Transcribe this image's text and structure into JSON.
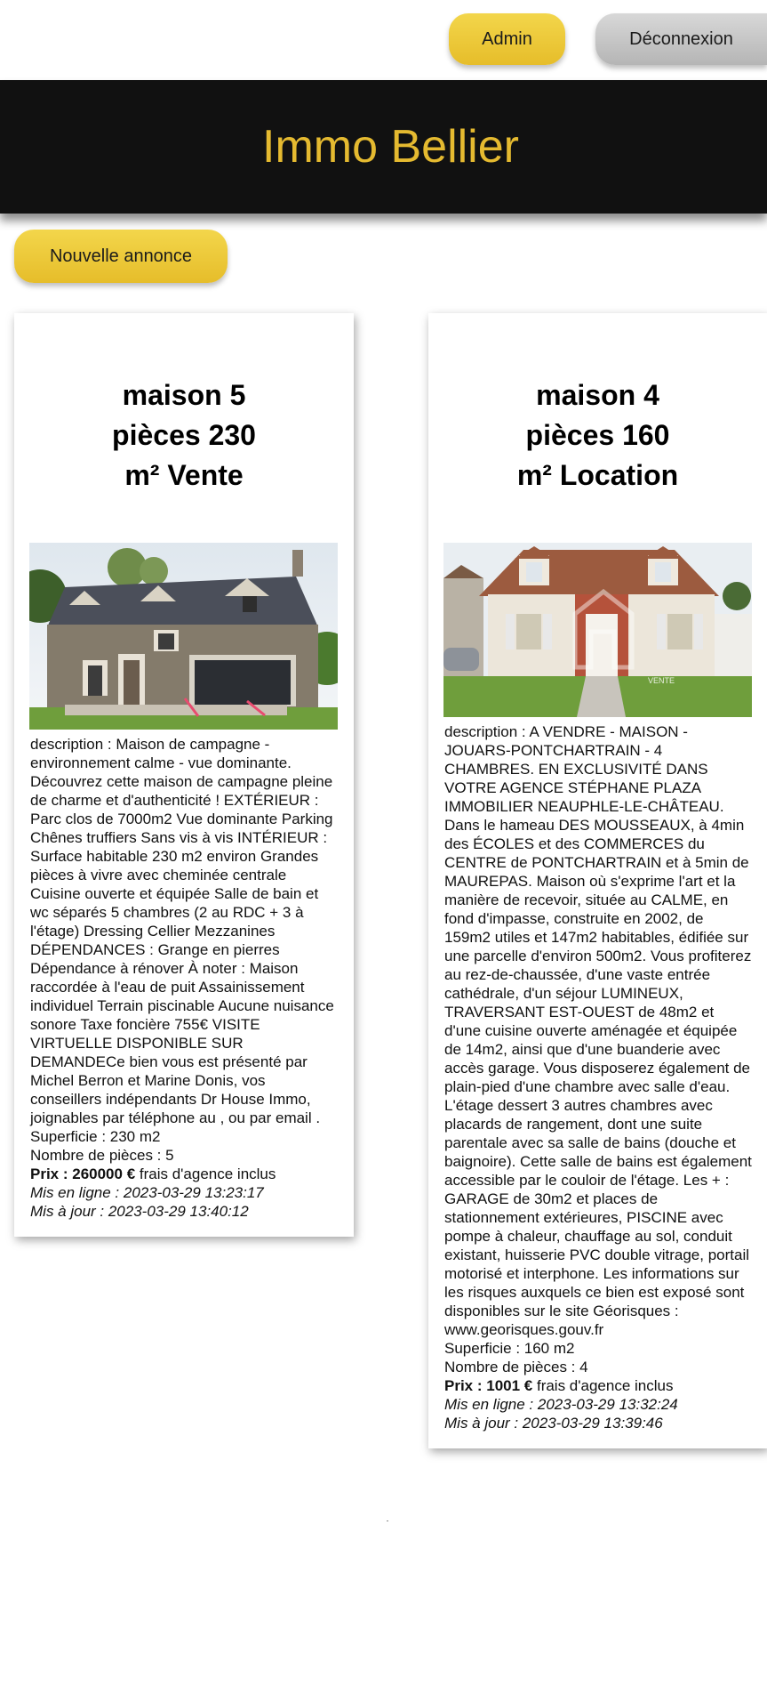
{
  "nav": {
    "admin_label": "Admin",
    "logout_label": "Déconnexion"
  },
  "header": {
    "title": "Immo Bellier"
  },
  "actions": {
    "new_listing_label": "Nouvelle annonce"
  },
  "listings": [
    {
      "title_lines": [
        "maison 5",
        "pièces 230",
        "m² Vente"
      ],
      "description": "description : Maison de campagne - environnement calme - vue dominante. Découvrez cette maison de campagne pleine de charme et d'authenticité ! EXTÉRIEUR : Parc clos de 7000m2 Vue dominante Parking Chênes truffiers Sans vis à vis INTÉRIEUR : Surface habitable 230 m2 environ Grandes pièces à vivre avec cheminée centrale Cuisine ouverte et équipée Salle de bain et wc séparés 5 chambres (2 au RDC + 3 à l'étage) Dressing Cellier Mezzanines DÉPENDANCES : Grange en pierres Dépendance à rénover À noter : Maison raccordée à l'eau de puit Assainissement individuel Terrain piscinable Aucune nuisance sonore Taxe foncière 755€ VISITE VIRTUELLE DISPONIBLE SUR DEMANDECe bien vous est présenté par Michel Berron et Marine Donis, vos conseillers indépendants Dr House Immo, joignables par téléphone au , ou par email .",
      "surface": "Superficie : 230 m2",
      "rooms": "Nombre de pièces : 5",
      "price_label": "Prix : 260000 €",
      "price_note": " frais d'agence inclus",
      "online": "Mis en ligne : 2023-03-29 13:23:17",
      "updated": "Mis à jour : 2023-03-29 13:40:12"
    },
    {
      "title_lines": [
        "maison 4",
        "pièces 160",
        "m² Location"
      ],
      "description": "description : A VENDRE - MAISON - JOUARS-PONTCHARTRAIN - 4 CHAMBRES. EN EXCLUSIVITÉ DANS VOTRE AGENCE STÉPHANE PLAZA IMMOBILIER NEAUPHLE-LE-CHÂTEAU. Dans le hameau DES MOUSSEAUX, à 4min des ÉCOLES et des COMMERCES du CENTRE de PONTCHARTRAIN et à 5min de MAUREPAS. Maison où s'exprime l'art et la manière de recevoir, située au CALME, en fond d'impasse, construite en 2002, de 159m2 utiles et 147m2 habitables, édifiée sur une parcelle d'environ 500m2. Vous profiterez au rez-de-chaussée, d'une vaste entrée cathédrale, d'un séjour LUMINEUX, TRAVERSANT EST-OUEST de 48m2 et d'une cuisine ouverte aménagée et équipée de 14m2, ainsi que d'une buanderie avec accès garage. Vous disposerez également de plain-pied d'une chambre avec salle d'eau. L'étage dessert 3 autres chambres avec placards de rangement, dont une suite parentale avec sa salle de bains (douche et baignoire). Cette salle de bains est également accessible par le couloir de l'étage. Les + : GARAGE de 30m2 et places de stationnement extérieures, PISCINE avec pompe à chaleur, chauffage au sol, conduit existant, huisserie PVC double vitrage, portail motorisé et interphone. Les informations sur les risques auxquels ce bien est exposé sont disponibles sur le site Géorisques : www.georisques.gouv.fr",
      "surface": "Superficie : 160 m2",
      "rooms": "Nombre de pièces : 4",
      "price_label": "Prix : 1001 €",
      "price_note": " frais d'agence inclus",
      "online": "Mis en ligne : 2023-03-29 13:32:24",
      "updated": "Mis à jour : 2023-03-29 13:39:46",
      "photo_watermark": "VENTE"
    }
  ],
  "colors": {
    "accent": "#e5ba30",
    "header_bg": "#111111"
  }
}
